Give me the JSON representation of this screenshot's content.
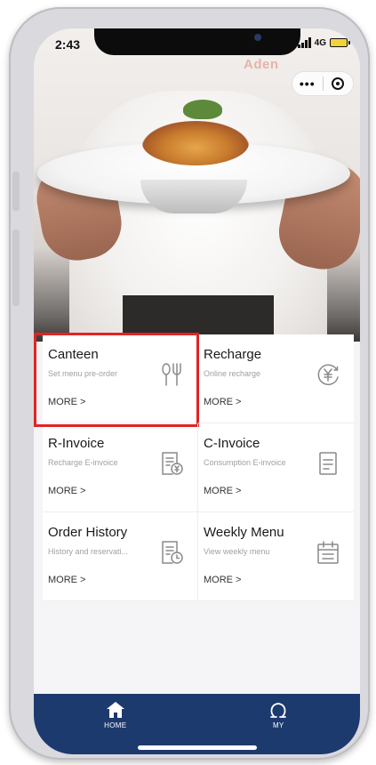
{
  "status_bar": {
    "time": "2:43",
    "network": "4G"
  },
  "hero": {
    "brand_text": "Aden"
  },
  "capsule": {
    "more_label": "•••"
  },
  "menu": [
    {
      "title": "Canteen",
      "subtitle": "Set menu pre-order",
      "more": "MORE >",
      "icon": "utensils-icon"
    },
    {
      "title": "Recharge",
      "subtitle": "Online recharge",
      "more": "MORE >",
      "icon": "yen-refresh-icon"
    },
    {
      "title": "R-Invoice",
      "subtitle": "Recharge E-invoice",
      "more": "MORE >",
      "icon": "invoice-yen-icon"
    },
    {
      "title": "C-Invoice",
      "subtitle": "Consumption E-invoice",
      "more": "MORE >",
      "icon": "document-icon"
    },
    {
      "title": "Order History",
      "subtitle": "History and reservati...",
      "more": "MORE >",
      "icon": "history-icon"
    },
    {
      "title": "Weekly Menu",
      "subtitle": "View weekly menu",
      "more": "MORE >",
      "icon": "calendar-icon"
    }
  ],
  "tabbar": {
    "home_label": "HOME",
    "my_label": "MY"
  },
  "colors": {
    "tabbar_bg": "#1d3a6e",
    "highlight": "#e02424"
  }
}
